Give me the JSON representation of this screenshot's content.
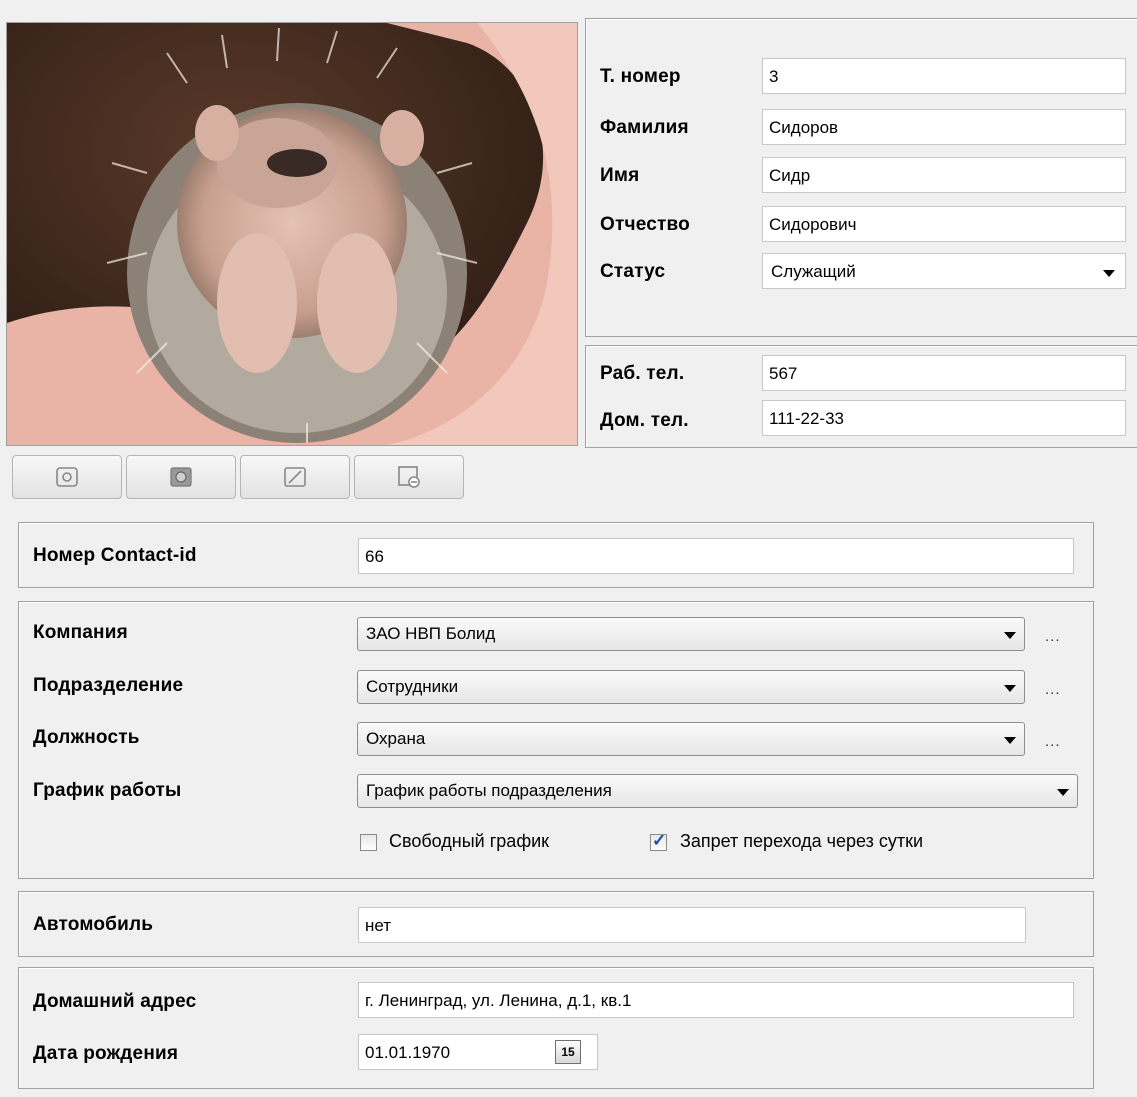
{
  "person": {
    "tab_number_label": "Т. номер",
    "tab_number": "3",
    "last_name_label": "Фамилия",
    "last_name": "Сидоров",
    "first_name_label": "Имя",
    "first_name": "Сидр",
    "patronymic_label": "Отчество",
    "patronymic": "Сидорович",
    "status_label": "Статус",
    "status": "Служащий"
  },
  "phones": {
    "work_label": "Раб. тел.",
    "work": "567",
    "home_label": "Дом. тел.",
    "home": "111-22-33"
  },
  "photo_toolbar": {
    "icons": [
      "photo-open-icon",
      "photo-capture-icon",
      "photo-edit-icon",
      "photo-clear-icon"
    ]
  },
  "contact": {
    "label": "Номер Contact-id",
    "value": "66"
  },
  "org": {
    "company_label": "Компания",
    "company": "ЗАО НВП Болид",
    "department_label": "Подразделение",
    "department": "Сотрудники",
    "position_label": "Должность",
    "position": "Охрана",
    "schedule_label": "График работы",
    "schedule": "График работы подразделения",
    "more": "...",
    "free_schedule_label": "Свободный график",
    "free_schedule_checked": false,
    "no_overnight_label": "Запрет перехода через сутки",
    "no_overnight_checked": true
  },
  "car": {
    "label": "Автомобиль",
    "value": "нет"
  },
  "address": {
    "home_address_label": "Домашний адрес",
    "home_address": "г. Ленинград, ул. Ленина, д.1, кв.1",
    "birth_date_label": "Дата рождения",
    "birth_date": "01.01.1970",
    "calendar_day": "15"
  }
}
